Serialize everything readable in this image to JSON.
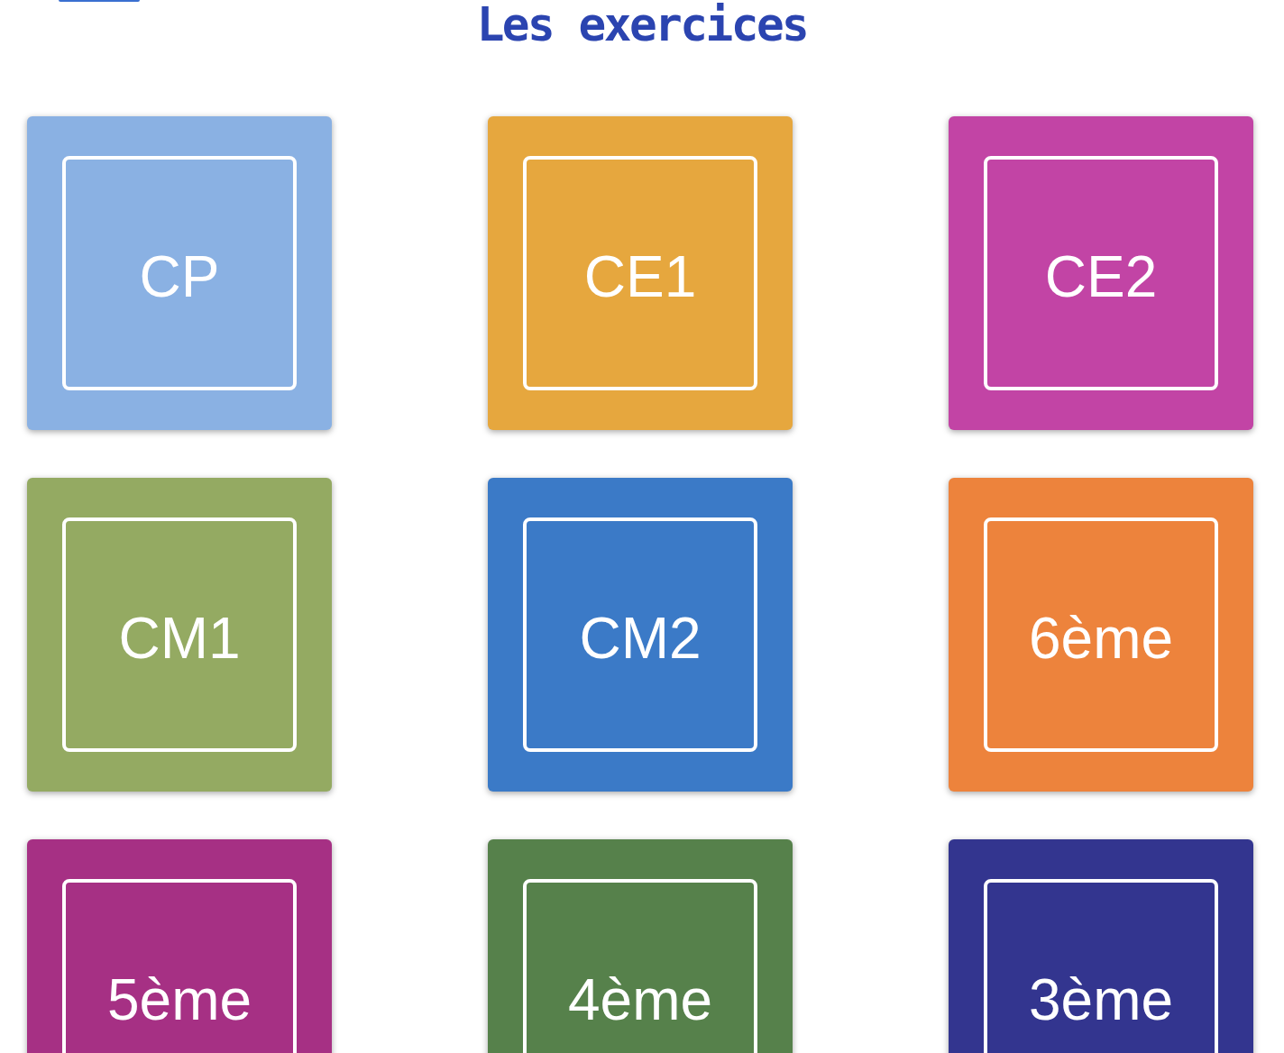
{
  "title": "Les exercices",
  "tiles": [
    {
      "label": "CP",
      "color": "#8ab1e3"
    },
    {
      "label": "CE1",
      "color": "#e6a73e"
    },
    {
      "label": "CE2",
      "color": "#c244a5"
    },
    {
      "label": "CM1",
      "color": "#94aa62"
    },
    {
      "label": "CM2",
      "color": "#3b7ac7"
    },
    {
      "label": "6ème",
      "color": "#ed833c"
    },
    {
      "label": "5ème",
      "color": "#a63084"
    },
    {
      "label": "4ème",
      "color": "#56814b"
    },
    {
      "label": "3ème",
      "color": "#33358f"
    }
  ]
}
